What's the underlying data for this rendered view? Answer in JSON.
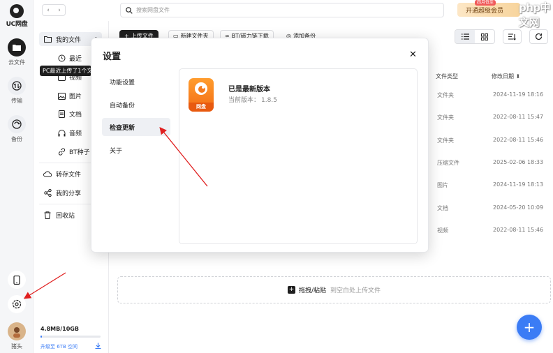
{
  "app": {
    "logo_text": "UC网盘"
  },
  "rail": [
    {
      "label": "云文件",
      "icon": "folder-icon"
    },
    {
      "label": "传输",
      "icon": "transfer-icon"
    },
    {
      "label": "备份",
      "icon": "backup-icon"
    }
  ],
  "topbar": {
    "search_placeholder": "搜索网盘文件",
    "vip_label": "开通超级会员",
    "vip_badge": "四月低至",
    "watermark": "php中文网"
  },
  "sidebar": {
    "my_files": "我的文件",
    "tooltip": "PC最近上传了1个文件",
    "subs": [
      "最近",
      "视频",
      "图片",
      "文档",
      "音频",
      "BT种子"
    ],
    "transfer": "转存文件",
    "share": "我的分享",
    "recycle": "回收站",
    "storage": "4.8MB/10GB",
    "storage_used_fraction": 0.0005,
    "upgrade": "升级至 6TB 空间"
  },
  "toolbar": {
    "upload": "上传文件",
    "new_folder": "新建文件夹",
    "bt": "BT/磁力链下载",
    "add_backup": "添加备份"
  },
  "table": {
    "col_type": "文件类型",
    "col_date": "修改日期",
    "rows": [
      {
        "type": "文件夹",
        "date": "2024-11-19 18:16"
      },
      {
        "type": "文件夹",
        "date": "2022-08-11 15:47"
      },
      {
        "type": "文件夹",
        "date": "2022-08-11 15:46"
      },
      {
        "type": "压缩文件",
        "date": "2025-02-06 18:33"
      },
      {
        "type": "图片",
        "date": "2024-11-19 18:13"
      },
      {
        "type": "文档",
        "date": "2024-05-20 10:09"
      },
      {
        "type": "视频",
        "date": "2022-08-11 15:46"
      }
    ]
  },
  "dropzone": {
    "main": "拖拽/粘贴",
    "hint": "到空白处上传文件"
  },
  "modal": {
    "title": "设置",
    "nav": [
      "功能设置",
      "自动备份",
      "检查更新",
      "关于"
    ],
    "active_index": 2,
    "app_icon_label": "网盘",
    "status": "已是最新版本",
    "version_label": "当前版本：",
    "version": "1.8.5"
  },
  "user": {
    "name": "猪头"
  },
  "colors": {
    "accent": "#3b7cf5",
    "dark": "#1f1f1f",
    "annotation": "#e02020"
  }
}
